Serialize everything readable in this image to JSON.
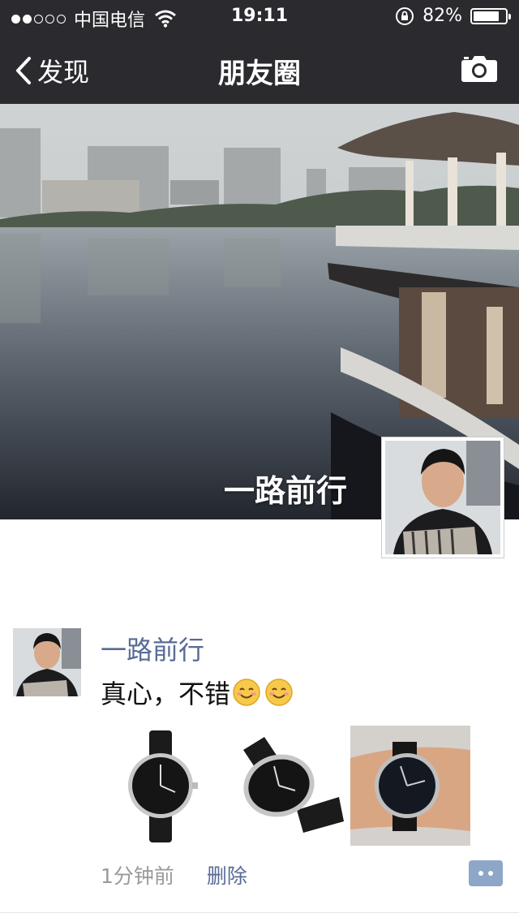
{
  "status_bar": {
    "carrier": "中国电信",
    "time": "19:11",
    "battery": "82%",
    "battery_level": 0.82,
    "signal_bars_filled": 2,
    "signal_bars_total": 5
  },
  "nav": {
    "back_label": "发现",
    "title": "朋友圈"
  },
  "cover": {
    "user_name": "一路前行"
  },
  "post": {
    "author": "一路前行",
    "text": "真心，不错",
    "emoji_count": 2,
    "photos": [
      "watch-front-photo",
      "watch-angled-photo",
      "watch-on-wrist-photo"
    ],
    "time_ago": "1分钟前",
    "delete_label": "删除"
  },
  "colors": {
    "nav_bg": "#2b2a2f",
    "link_blue": "#576b95",
    "time_gray": "#9a9a9a"
  }
}
